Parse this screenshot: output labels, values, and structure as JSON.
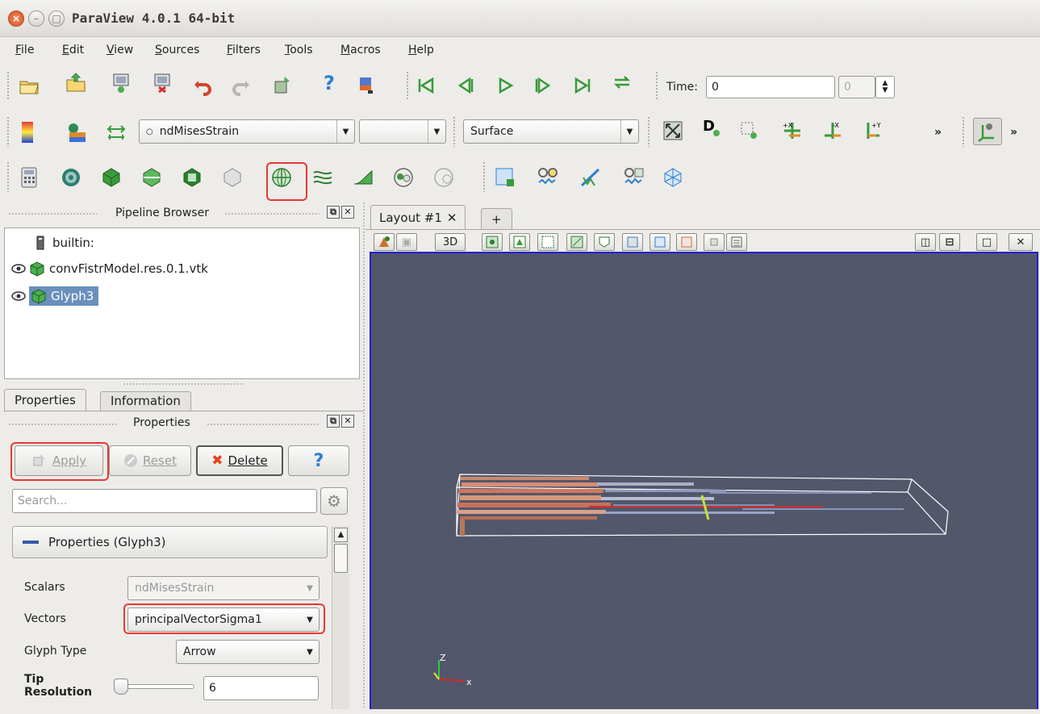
{
  "window": {
    "title": "ParaView 4.0.1 64-bit"
  },
  "menu": [
    {
      "pre": "",
      "u": "F",
      "post": "ile"
    },
    {
      "pre": "",
      "u": "E",
      "post": "dit"
    },
    {
      "pre": "",
      "u": "V",
      "post": "iew"
    },
    {
      "pre": "",
      "u": "S",
      "post": "ources"
    },
    {
      "pre": "",
      "u": "F",
      "post": "ilters"
    },
    {
      "pre": "",
      "u": "T",
      "post": "ools"
    },
    {
      "pre": "",
      "u": "M",
      "post": "acros"
    },
    {
      "pre": "",
      "u": "H",
      "post": "elp"
    }
  ],
  "time": {
    "label": "Time:",
    "value": "0",
    "index": "0"
  },
  "display": {
    "color_by": "ndMisesStrain",
    "component": "",
    "representation": "Surface",
    "more": "»"
  },
  "pipeline_browser": {
    "title": "Pipeline Browser",
    "items": [
      "builtin:",
      "convFistrModel.res.0.1.vtk",
      "Glyph3"
    ]
  },
  "tabs": {
    "properties": "Properties",
    "information": "Information"
  },
  "properties_panel": {
    "title": "Properties",
    "apply": "Apply",
    "reset": "Reset",
    "delete": "Delete",
    "help": "?",
    "search_placeholder": "Search...",
    "section": "Properties (Glyph3)",
    "scalars_label": "Scalars",
    "scalars_value": "ndMisesStrain",
    "vectors_label": "Vectors",
    "vectors_value": "principalVectorSigma1",
    "glyph_type_label": "Glyph Type",
    "glyph_type_value": "Arrow",
    "tip_resolution_label_1": "Tip",
    "tip_resolution_label_2": "Resolution",
    "tip_resolution_value": "6"
  },
  "layout": {
    "tab": "Layout #1",
    "close": "✕",
    "add": "+",
    "mode_3d": "3D"
  },
  "axes": {
    "z": "Z",
    "x": "x"
  },
  "colors": {
    "accent_red": "#e53935",
    "view_bg": "#52576b",
    "view_border": "#1f1fd6"
  }
}
